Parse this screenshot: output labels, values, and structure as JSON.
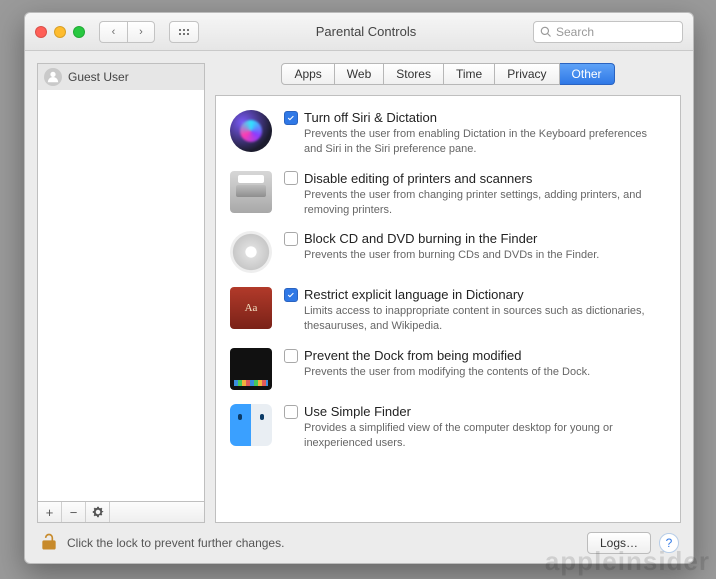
{
  "titlebar": {
    "title": "Parental Controls",
    "search_placeholder": "Search"
  },
  "sidebar": {
    "users": [
      {
        "name": "Guest User"
      }
    ],
    "add_label": "+",
    "remove_label": "−"
  },
  "tabs": [
    {
      "label": "Apps",
      "active": false
    },
    {
      "label": "Web",
      "active": false
    },
    {
      "label": "Stores",
      "active": false
    },
    {
      "label": "Time",
      "active": false
    },
    {
      "label": "Privacy",
      "active": false
    },
    {
      "label": "Other",
      "active": true
    }
  ],
  "options": [
    {
      "icon": "siri-icon",
      "checked": true,
      "title": "Turn off Siri & Dictation",
      "desc": "Prevents the user from enabling Dictation in the Keyboard preferences and Siri in the Siri preference pane."
    },
    {
      "icon": "printer-icon",
      "checked": false,
      "title": "Disable editing of printers and scanners",
      "desc": "Prevents the user from changing printer settings, adding printers, and removing printers."
    },
    {
      "icon": "cd-icon",
      "checked": false,
      "title": "Block CD and DVD burning in the Finder",
      "desc": "Prevents the user from burning CDs and DVDs in the Finder."
    },
    {
      "icon": "dictionary-icon",
      "checked": true,
      "title": "Restrict explicit language in Dictionary",
      "desc": "Limits access to inappropriate content in sources such as dictionaries, thesauruses, and Wikipedia."
    },
    {
      "icon": "dock-icon",
      "checked": false,
      "title": "Prevent the Dock from being modified",
      "desc": "Prevents the user from modifying the contents of the Dock."
    },
    {
      "icon": "finder-icon",
      "checked": false,
      "title": "Use Simple Finder",
      "desc": "Provides a simplified view of the computer desktop for young or inexperienced users."
    }
  ],
  "footer": {
    "lock_text": "Click the lock to prevent further changes.",
    "logs_label": "Logs…",
    "help_label": "?"
  },
  "watermark": "appleinsider"
}
